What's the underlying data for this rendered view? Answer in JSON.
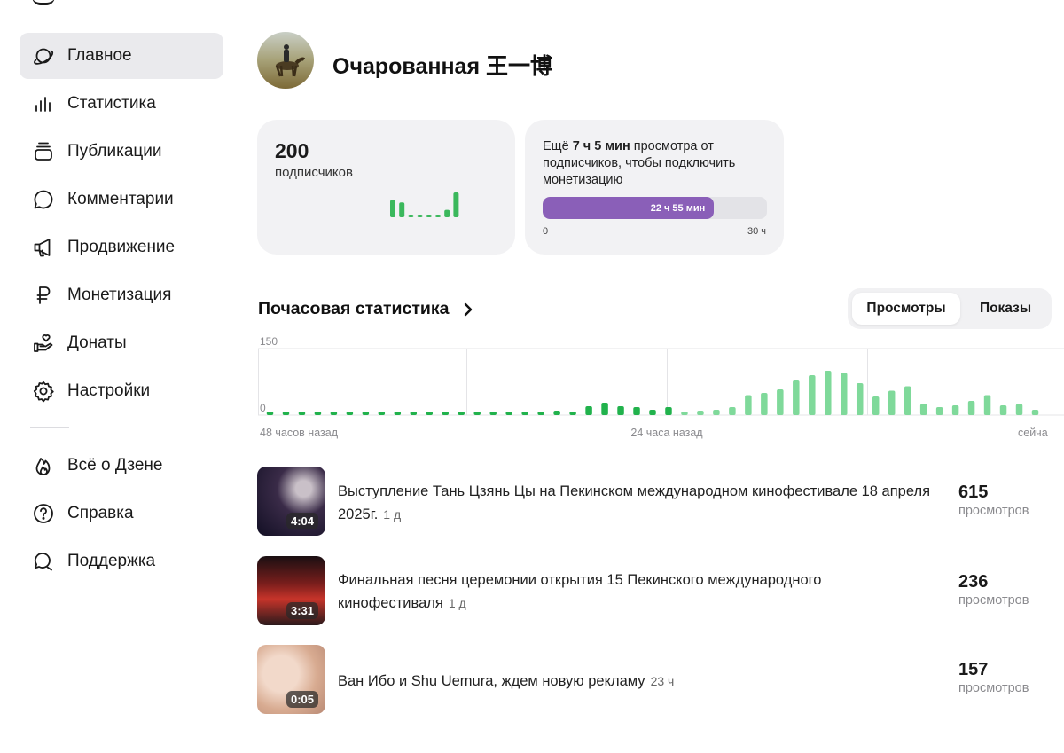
{
  "sidebar": {
    "items": [
      {
        "label": "Главное",
        "icon": "planet-icon",
        "active": true
      },
      {
        "label": "Статистика",
        "icon": "bar-chart-icon"
      },
      {
        "label": "Публикации",
        "icon": "stack-icon"
      },
      {
        "label": "Комментарии",
        "icon": "comment-icon"
      },
      {
        "label": "Продвижение",
        "icon": "megaphone-icon"
      },
      {
        "label": "Монетизация",
        "icon": "ruble-icon"
      },
      {
        "label": "Донаты",
        "icon": "donate-hand-icon"
      },
      {
        "label": "Настройки",
        "icon": "gear-icon"
      }
    ],
    "footer_items": [
      {
        "label": "Всё о Дзене",
        "icon": "flame-icon"
      },
      {
        "label": "Справка",
        "icon": "help-circle-icon"
      },
      {
        "label": "Поддержка",
        "icon": "support-chat-icon"
      }
    ]
  },
  "channel": {
    "name": "Очарованная 王一博"
  },
  "subscribers": {
    "count": "200",
    "label": "подписчиков",
    "sparkline": [
      0.7,
      0.6,
      0.08,
      0.08,
      0.08,
      0.08,
      0.3,
      1.0
    ],
    "color": "#3bb85c"
  },
  "monetization": {
    "text_before": "Ещё ",
    "text_bold": "7 ч 5 мин",
    "text_after": " просмотра от подписчиков, чтобы подключить монетизацию",
    "progress_label": "22 ч 55 мин",
    "progress_value": 0.764,
    "min_label": "0",
    "max_label": "30 ч",
    "color": "#8a5fb8"
  },
  "hourly": {
    "title": "Почасовая статистика",
    "tabs": [
      {
        "label": "Просмотры",
        "active": true
      },
      {
        "label": "Показы",
        "active": false
      }
    ]
  },
  "chart_data": {
    "type": "bar",
    "ylim": [
      0,
      150
    ],
    "yticks": [
      "150",
      "0"
    ],
    "xlabels": [
      "48 часов назад",
      "24 часа назад",
      "сейча"
    ],
    "grid": true,
    "dark_color": "#21b24c",
    "light_color": "#7fd99a",
    "values": [
      3,
      3,
      3,
      3,
      3,
      3,
      3,
      3,
      3,
      3,
      3,
      3,
      5,
      3,
      3,
      3,
      3,
      5,
      10,
      8,
      20,
      28,
      20,
      18,
      12,
      18,
      3,
      10,
      12,
      18,
      45,
      50,
      58,
      78,
      90,
      100,
      95,
      72,
      42,
      55,
      65,
      25,
      18,
      22,
      32,
      45,
      22,
      25,
      12
    ],
    "dark_count": 26
  },
  "videos": [
    {
      "title": "Выступление Тань Цзянь Цы на Пекинском международном кинофестивале 18 апреля 2025г.",
      "age": "1 д",
      "duration": "4:04",
      "views": "615",
      "views_label": "просмотров"
    },
    {
      "title": "Финальная песня церемонии открытия 15 Пекинского международного кинофестиваля",
      "age": "1 д",
      "duration": "3:31",
      "views": "236",
      "views_label": "просмотров"
    },
    {
      "title": "Ван Ибо и Shu Uemura, ждем новую рекламу",
      "age": "23 ч",
      "duration": "0:05",
      "views": "157",
      "views_label": "просмотров"
    }
  ]
}
